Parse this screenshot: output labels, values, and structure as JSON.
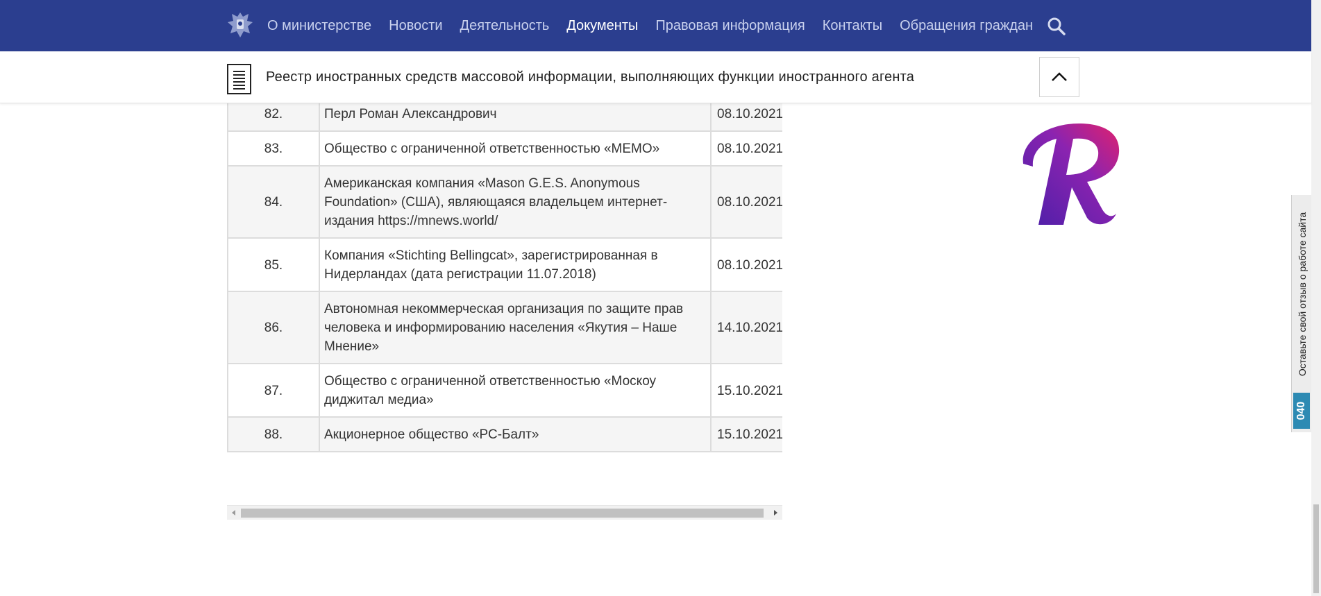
{
  "nav": {
    "items": [
      {
        "label": "О министерстве",
        "active": false
      },
      {
        "label": "Новости",
        "active": false
      },
      {
        "label": "Деятельность",
        "active": false
      },
      {
        "label": "Документы",
        "active": true
      },
      {
        "label": "Правовая информация",
        "active": false
      },
      {
        "label": "Контакты",
        "active": false
      },
      {
        "label": "Обращения граждан",
        "active": false
      }
    ],
    "emblem_icon": "coat-of-arms-icon",
    "search_icon": "search-icon",
    "background": "#2b3e8f"
  },
  "subheader": {
    "title": "Реестр иностранных средств массовой информации, выполняющих функции иностранного агента",
    "doc_icon": "document-icon",
    "up_icon": "chevron-up-icon"
  },
  "table": {
    "rows": [
      {
        "num": "82.",
        "name": "Перл Роман Александрович",
        "date": "08.10.2021"
      },
      {
        "num": "83.",
        "name": "Общество с ограниченной ответственностью «МЕМО»",
        "date": "08.10.2021"
      },
      {
        "num": "84.",
        "name": "Американская компания «Mason G.E.S. Anonymous Foundation» (США), являющаяся владельцем интернет-издания https://mnews.world/",
        "date": "08.10.2021"
      },
      {
        "num": "85.",
        "name": "Компания «Stichting Bellingcat», зарегистрированная в Нидерландах (дата регистрации 11.07.2018)",
        "date": "08.10.2021"
      },
      {
        "num": "86.",
        "name": "Автономная некоммерческая организация по защите прав человека и информированию населения «Якутия – Наше Мнение»",
        "date": "14.10.2021"
      },
      {
        "num": "87.",
        "name": "Общество с ограниченной ответственностью «Москоу диджитал медиа»",
        "date": "15.10.2021"
      },
      {
        "num": "88.",
        "name": "Акционерное общество «РС-Балт»",
        "date": "15.10.2021"
      }
    ]
  },
  "feedback": {
    "text": "Оставьте свой отзыв о работе сайта",
    "count": "040",
    "accent": "#2d8ab3"
  },
  "logo_icon": "r-letter-logo"
}
